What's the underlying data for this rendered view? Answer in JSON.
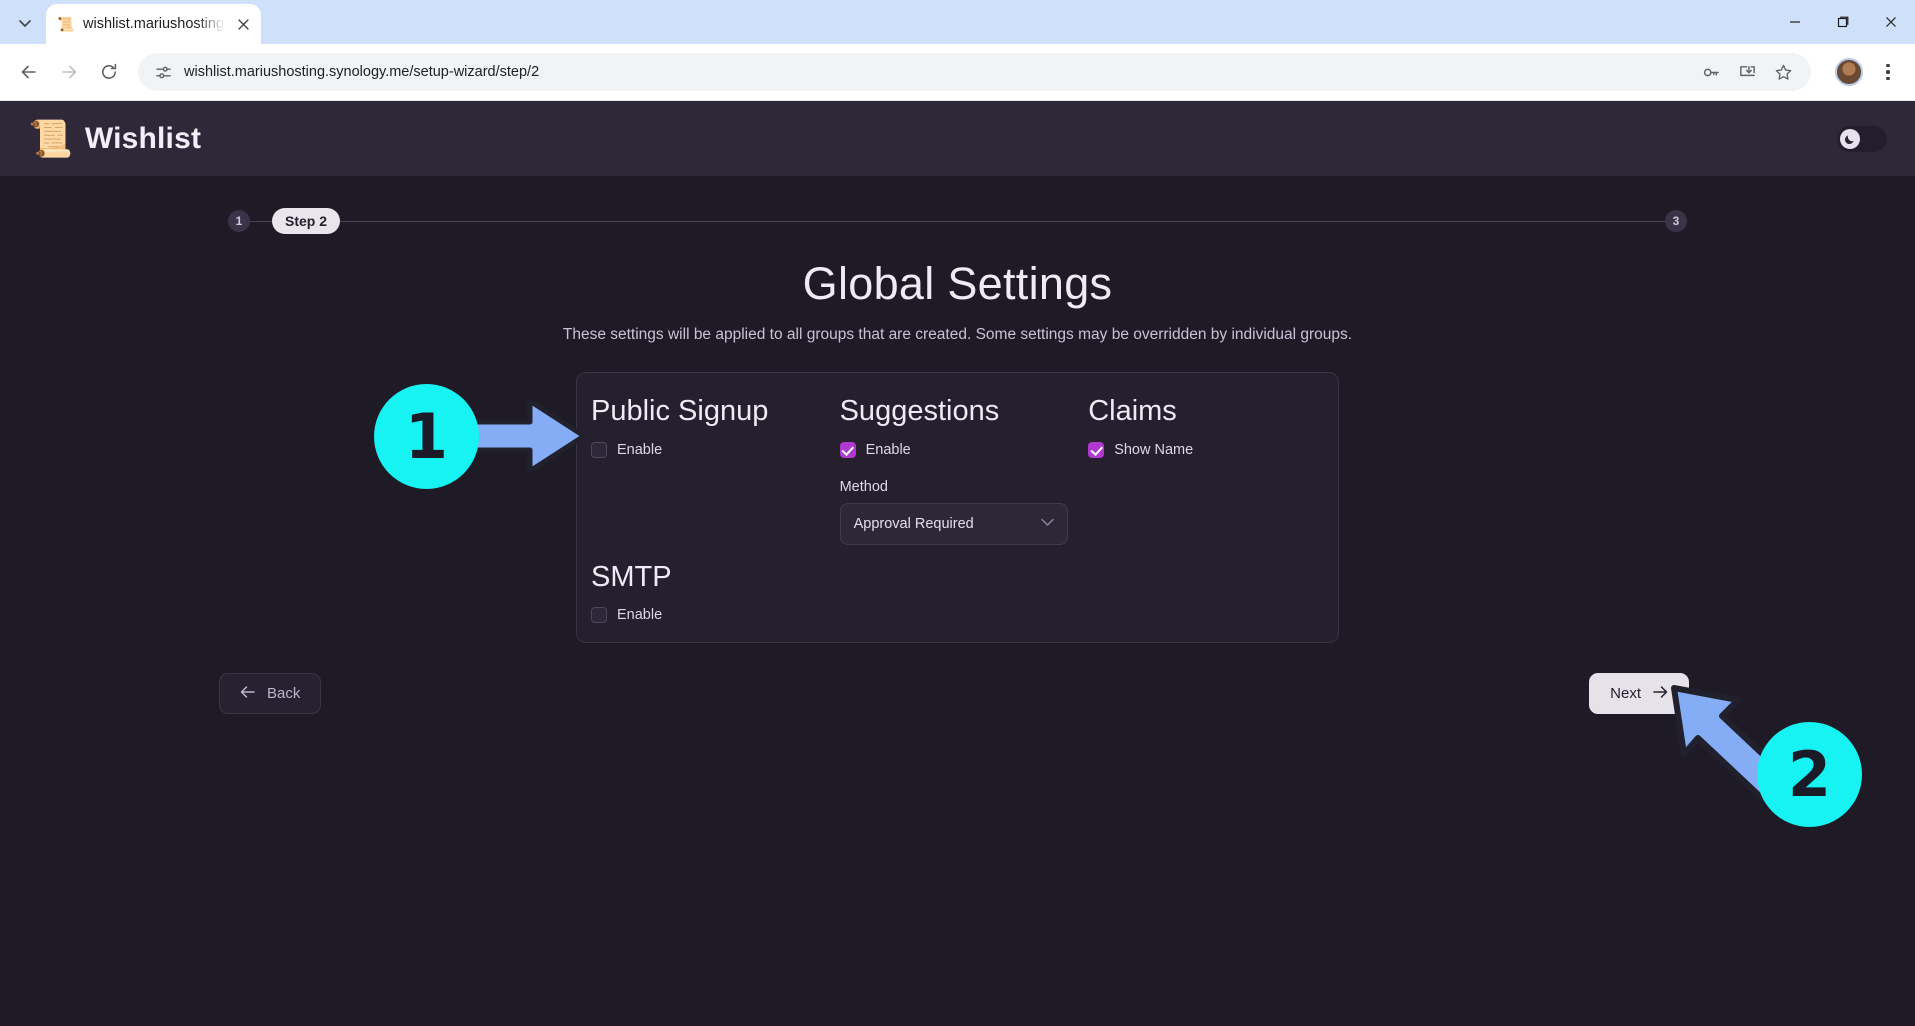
{
  "browser": {
    "tab": {
      "title": "wishlist.mariushosting.synology",
      "favicon": "📜",
      "close_icon": "✕"
    },
    "tab_search_icon": "chevron-down",
    "window_controls": {
      "minimize": "—",
      "maximize": "❐",
      "close": "✕"
    },
    "nav": {
      "back_icon": "←",
      "forward_icon": "→",
      "reload_icon": "⟳"
    },
    "omnibox": {
      "site_info_icon": "tune-icon",
      "url": "wishlist.mariushosting.synology.me/setup-wizard/step/2",
      "password_icon": "key-icon",
      "install_icon": "install-app-icon",
      "bookmark_icon": "star-icon"
    },
    "profile_icon": "avatar",
    "menu_icon": "three-dots"
  },
  "app": {
    "brand": {
      "emoji": "📜",
      "name": "Wishlist"
    },
    "theme_toggle": {
      "icon": "🌙",
      "state": "dark"
    }
  },
  "wizard": {
    "steps": [
      {
        "label": "1",
        "type": "dot",
        "state": "complete"
      },
      {
        "label": "Step 2",
        "type": "pill",
        "state": "current"
      },
      {
        "label": "3",
        "type": "dot",
        "state": "upcoming"
      }
    ],
    "title": "Global Settings",
    "subtitle": "These settings will be applied to all groups that are created. Some settings may be overridden by individual groups.",
    "back_button": {
      "label": "Back",
      "icon": "←"
    },
    "next_button": {
      "label": "Next",
      "icon": "→"
    }
  },
  "settings": {
    "public_signup": {
      "heading": "Public Signup",
      "enable": {
        "label": "Enable",
        "checked": false
      }
    },
    "suggestions": {
      "heading": "Suggestions",
      "enable": {
        "label": "Enable",
        "checked": true
      },
      "method": {
        "label": "Method",
        "value": "Approval Required",
        "caret_icon": "chevron-down"
      }
    },
    "claims": {
      "heading": "Claims",
      "show_name": {
        "label": "Show Name",
        "checked": true
      }
    },
    "smtp": {
      "heading": "SMTP",
      "enable": {
        "label": "Enable",
        "checked": false
      }
    }
  },
  "annotations": [
    {
      "number": "1",
      "target": "public-signup-enable-checkbox"
    },
    {
      "number": "2",
      "target": "next-button"
    }
  ],
  "colors": {
    "accent_checkbox": "#b03ad0",
    "annotation_circle": "#17f2f2",
    "annotation_arrow": "#85adf5",
    "page_bg": "#1e1b26",
    "header_bg": "#2f2839",
    "card_bg": "#251f2e"
  }
}
